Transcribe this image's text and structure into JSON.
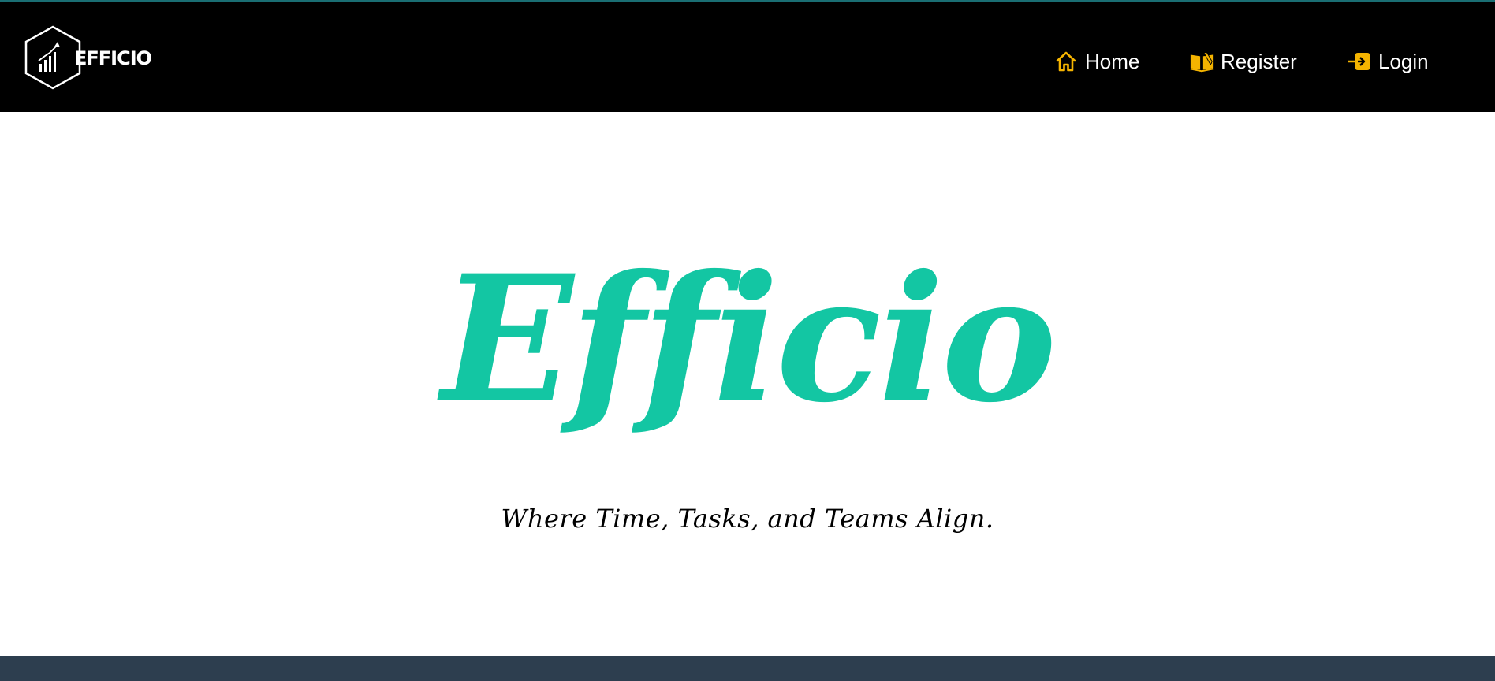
{
  "brand": {
    "logo_text": "EFFICIO"
  },
  "nav": {
    "items": [
      {
        "label": "Home",
        "icon": "home-icon"
      },
      {
        "label": "Register",
        "icon": "register-book-icon"
      },
      {
        "label": "Login",
        "icon": "login-icon"
      }
    ]
  },
  "hero": {
    "title": "Efficio",
    "tagline": "Where Time, Tasks, and Teams Align."
  },
  "colors": {
    "navbar_bg": "#000000",
    "accent_line": "#1a6e73",
    "icon_gold": "#f5b400",
    "title_teal": "#13c6a3",
    "footer_bg": "#2d3e4f"
  }
}
